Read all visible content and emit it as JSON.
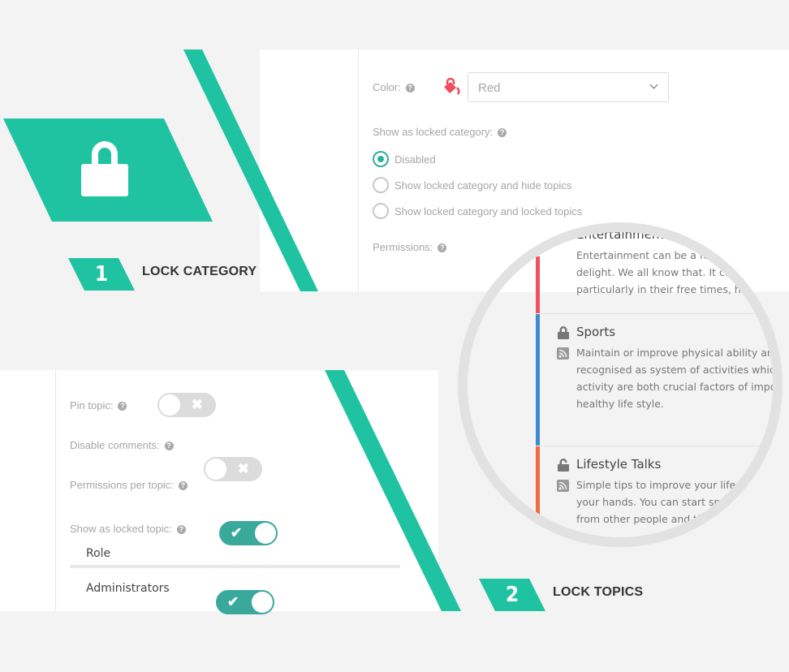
{
  "colors": {
    "brand_teal": "#1fc3a1",
    "toggle_on": "#3aa99c",
    "entertainment": "#ef5160",
    "sports": "#3d8bd0",
    "lifestyle": "#f26d3d",
    "paint_icon": "#ef4b5c"
  },
  "step1": {
    "number": "1",
    "title": "LOCK CATEGORY",
    "hero_icon": "padlock-icon"
  },
  "category_form": {
    "color_label": "Color:",
    "color_value": "Red",
    "locked_label": "Show as locked category:",
    "radio_options": [
      {
        "label": "Disabled",
        "selected": true
      },
      {
        "label": "Show locked category and hide topics",
        "selected": false
      },
      {
        "label": "Show locked category and locked topics",
        "selected": false
      }
    ],
    "permissions_label": "Permissions:"
  },
  "topic_form": {
    "toggles": [
      {
        "label": "Pin topic:",
        "on": false
      },
      {
        "label": "Disable comments:",
        "on": false
      },
      {
        "label": "Permissions per topic:",
        "on": true
      },
      {
        "label": "Show as locked topic:",
        "on": true
      }
    ],
    "table_header": "Role",
    "table_rows": [
      "Administrators"
    ]
  },
  "step2": {
    "number": "2",
    "title": "LOCK TOPICS"
  },
  "forums": [
    {
      "title": "Entertainment",
      "locked": null,
      "lines": [
        "Entertainment can be a for",
        "delight. We all know that. It car",
        "particularly in their free times, help"
      ]
    },
    {
      "title": "Sports",
      "locked": true,
      "lines": [
        "Maintain or improve physical ability and",
        "recognised as system of activities which a",
        "activity are both crucial factors of import",
        "healthy life style."
      ]
    },
    {
      "title": "Lifestyle Talks",
      "locked": false,
      "lines": [
        "Simple tips to improve your lifest",
        "your hands. You can start smal",
        "from other people and th"
      ]
    }
  ]
}
